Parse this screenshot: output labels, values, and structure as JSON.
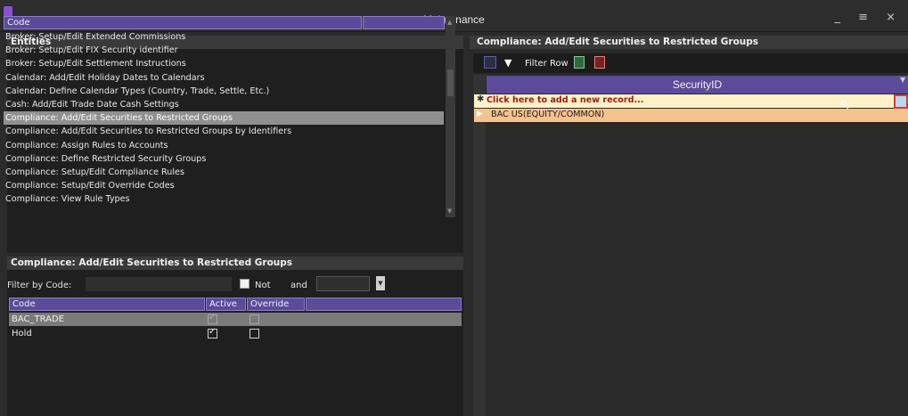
{
  "window": {
    "title": "Maintenance",
    "controls": "_ ≡ ×"
  },
  "entities": {
    "header": "Entities",
    "column": "Code",
    "items": [
      "Broker: Setup/Edit Extended Commissions",
      "Broker: Setup/Edit FIX Security identifier",
      "Broker: Setup/Edit Settlement Instructions",
      "Calendar: Add/Edit Holiday Dates to Calendars",
      "Calendar: Define Calendar Types (Country, Trade, Settle, Etc.)",
      "Cash: Add/Edit Trade Date Cash Settings",
      "Compliance: Add/Edit Securities to Restricted Groups",
      "Compliance: Add/Edit Securities to Restricted Groups by Identifiers",
      "Compliance: Assign Rules to Accounts",
      "Compliance: Define Restricted Security Groups",
      "Compliance: Setup/Edit Compliance Rules",
      "Compliance: Setup/Edit Override Codes",
      "Compliance: View Rule Types"
    ],
    "selected_index": 6
  },
  "detail": {
    "header": "Compliance: Add/Edit Securities to Restricted Groups",
    "filter_label": "Filter by Code:",
    "filter_value": "",
    "not_label": "Not",
    "and_label": "and",
    "columns": [
      "Code",
      "Active",
      "Override"
    ],
    "rows": [
      {
        "code": "BAC_TRADE",
        "active": true,
        "override": false
      },
      {
        "code": "Hold",
        "active": true,
        "override": false
      }
    ]
  },
  "right": {
    "header": "Compliance: Add/Edit Securities to Restricted Groups",
    "toolbar": {
      "filter_row": "Filter Row"
    },
    "column": "SecurityID",
    "new_record": "Click here to add a new record...",
    "rows": [
      "BAC US(EQUITY/COMMON)"
    ]
  },
  "colors": {
    "accent_header": "#5b4b9a",
    "selected_row": "#8f8f8f",
    "new_row_bg": "#fff2c6",
    "data_row_bg": "#f5c38e"
  }
}
